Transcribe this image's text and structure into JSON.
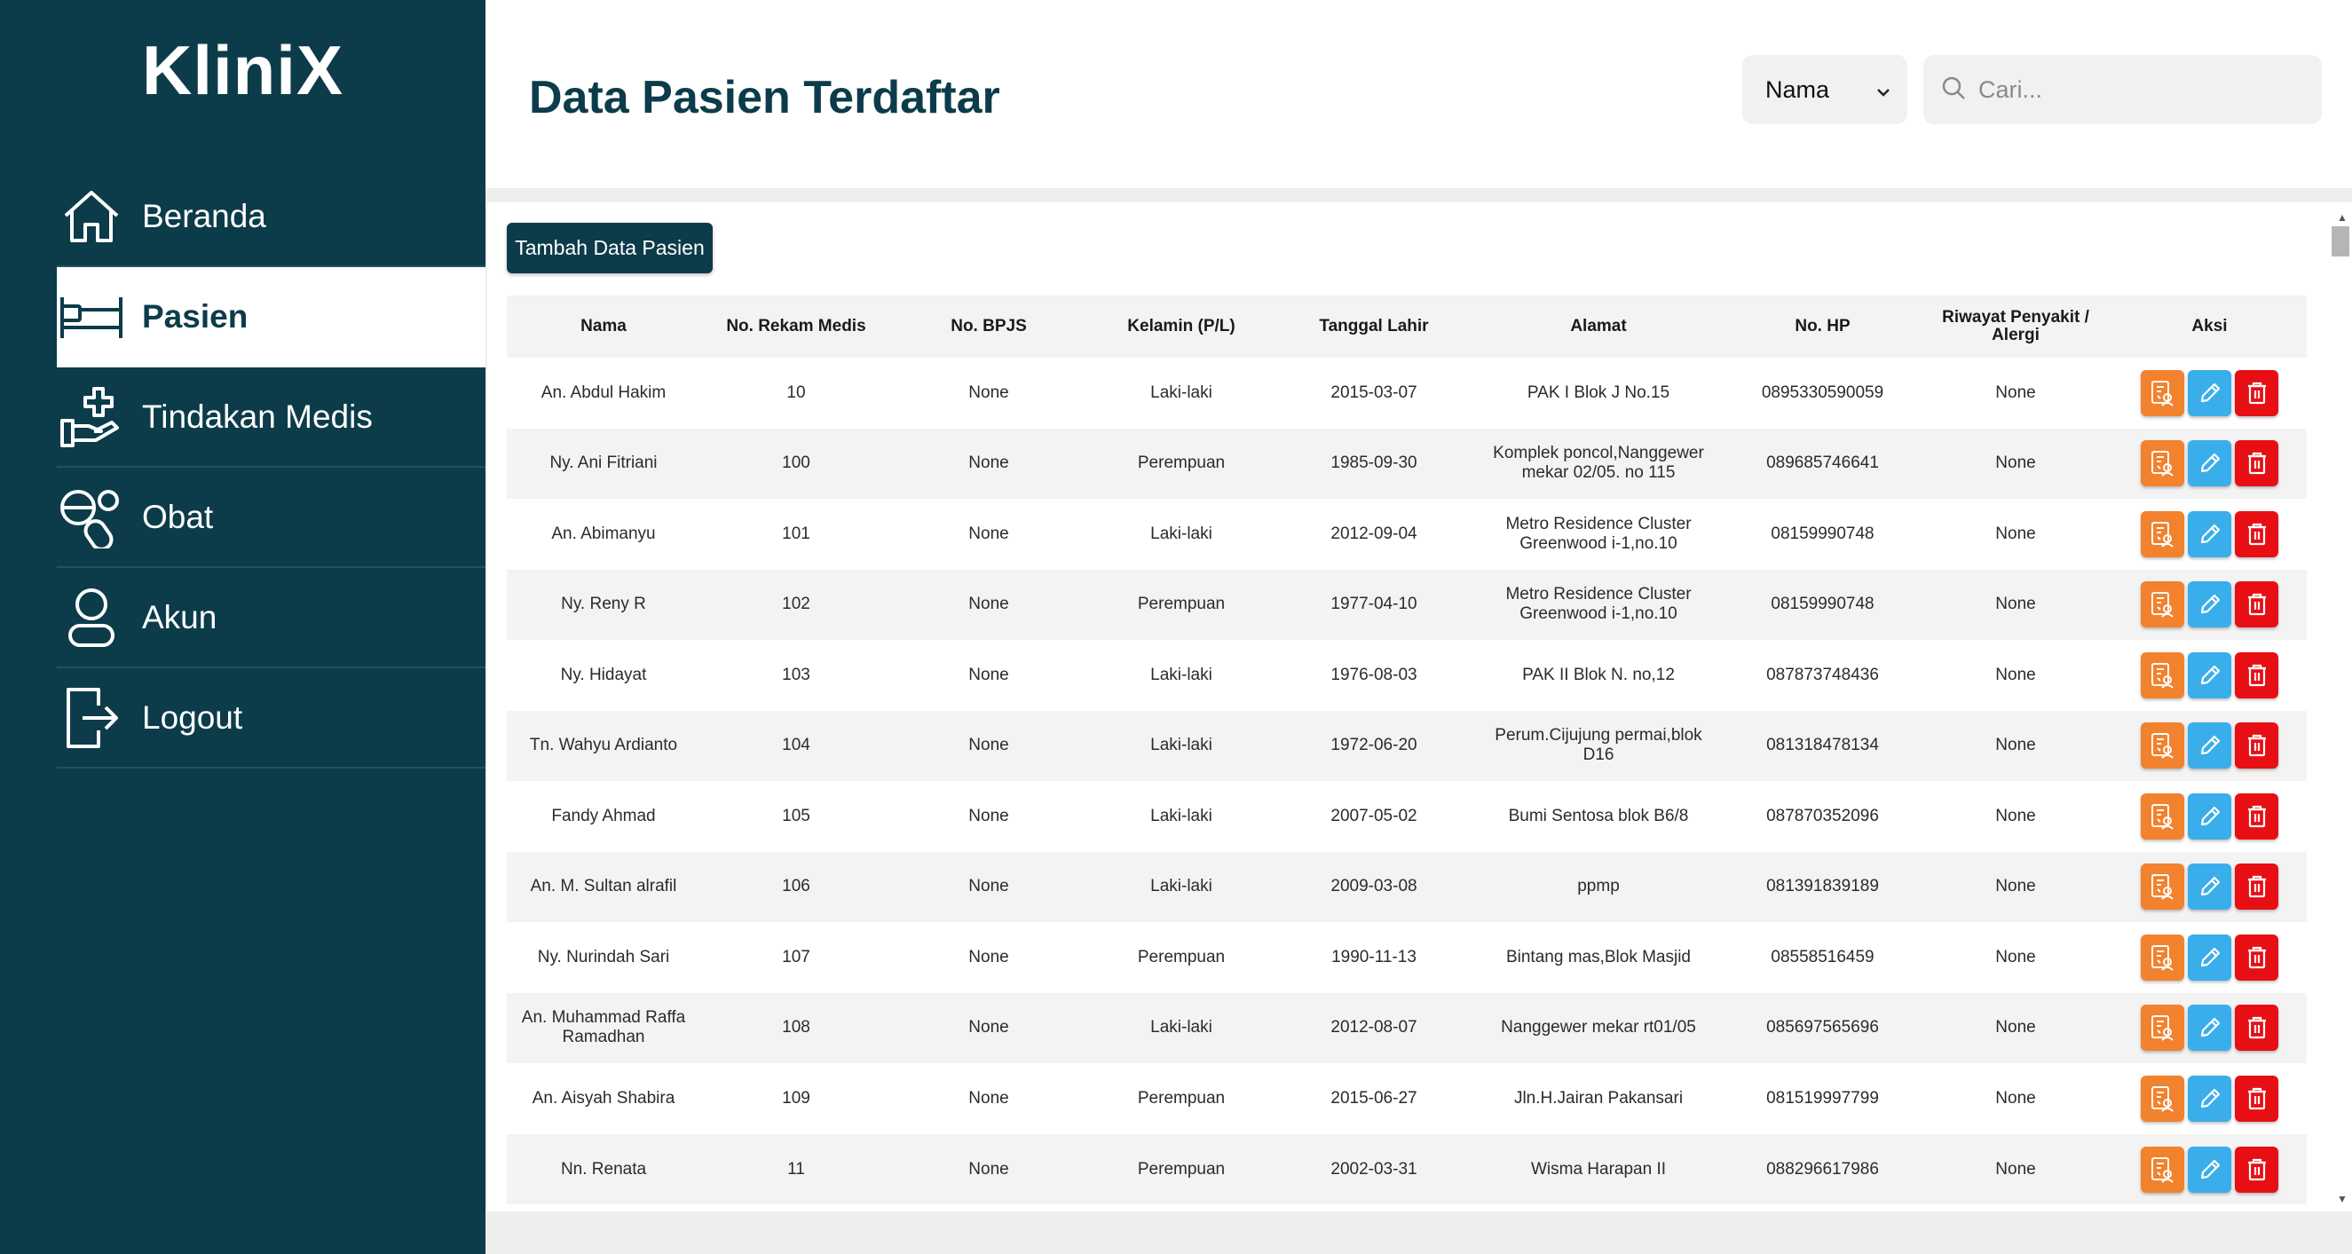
{
  "app": {
    "logo": "KliniX"
  },
  "sidebar": {
    "items": [
      {
        "label": "Beranda",
        "icon": "home-icon"
      },
      {
        "label": "Pasien",
        "icon": "bed-icon",
        "active": true
      },
      {
        "label": "Tindakan Medis",
        "icon": "hand-medical-icon"
      },
      {
        "label": "Obat",
        "icon": "pills-icon"
      },
      {
        "label": "Akun",
        "icon": "user-icon"
      },
      {
        "label": "Logout",
        "icon": "logout-icon"
      }
    ]
  },
  "header": {
    "title": "Data Pasien Terdaftar",
    "filter": {
      "selected": "Nama",
      "icon": "chevron-down-icon"
    },
    "search": {
      "placeholder": "Cari...",
      "value": "",
      "icon": "search-icon"
    }
  },
  "toolbar": {
    "add_label": "Tambah Data Pasien"
  },
  "table": {
    "columns": [
      "Nama",
      "No. Rekam Medis",
      "No. BPJS",
      "Kelamin (P/L)",
      "Tanggal Lahir",
      "Alamat",
      "No. HP",
      "Riwayat Penyakit / Alergi",
      "Aksi"
    ],
    "rows": [
      [
        "An. Abdul Hakim",
        "10",
        "None",
        "Laki-laki",
        "2015-03-07",
        "PAK I Blok J No.15",
        "0895330590059",
        "None"
      ],
      [
        "Ny. Ani Fitriani",
        "100",
        "None",
        "Perempuan",
        "1985-09-30",
        "Komplek poncol,Nanggewer mekar 02/05. no 115",
        "089685746641",
        "None"
      ],
      [
        "An. Abimanyu",
        "101",
        "None",
        "Laki-laki",
        "2012-09-04",
        "Metro Residence Cluster Greenwood i-1,no.10",
        "08159990748",
        "None"
      ],
      [
        "Ny. Reny R",
        "102",
        "None",
        "Perempuan",
        "1977-04-10",
        "Metro Residence Cluster Greenwood i-1,no.10",
        "08159990748",
        "None"
      ],
      [
        "Ny. Hidayat",
        "103",
        "None",
        "Laki-laki",
        "1976-08-03",
        "PAK II Blok N. no,12",
        "087873748436",
        "None"
      ],
      [
        "Tn. Wahyu Ardianto",
        "104",
        "None",
        "Laki-laki",
        "1972-06-20",
        "Perum.Cijujung permai,blok D16",
        "081318478134",
        "None"
      ],
      [
        "Fandy Ahmad",
        "105",
        "None",
        "Laki-laki",
        "2007-05-02",
        "Bumi Sentosa blok B6/8",
        "087870352096",
        "None"
      ],
      [
        "An. M. Sultan alrafil",
        "106",
        "None",
        "Laki-laki",
        "2009-03-08",
        "ppmp",
        "081391839189",
        "None"
      ],
      [
        "Ny. Nurindah Sari",
        "107",
        "None",
        "Perempuan",
        "1990-11-13",
        "Bintang mas,Blok Masjid",
        "08558516459",
        "None"
      ],
      [
        "An. Muhammad Raffa Ramadhan",
        "108",
        "None",
        "Laki-laki",
        "2012-08-07",
        "Nanggewer mekar rt01/05",
        "085697565696",
        "None"
      ],
      [
        "An. Aisyah Shabira",
        "109",
        "None",
        "Perempuan",
        "2015-06-27",
        "Jln.H.Jairan Pakansari",
        "081519997799",
        "None"
      ],
      [
        "Nn. Renata",
        "11",
        "None",
        "Perempuan",
        "2002-03-31",
        "Wisma Harapan II",
        "088296617986",
        "None"
      ]
    ],
    "row_actions": [
      {
        "name": "medical-record-button",
        "icon": "medical-record-icon",
        "color": "#f2822e"
      },
      {
        "name": "edit-button",
        "icon": "pencil-icon",
        "color": "#3aaeea"
      },
      {
        "name": "delete-button",
        "icon": "trash-icon",
        "color": "#e80f14"
      }
    ]
  },
  "colors": {
    "sidebar": "#0c3c4a",
    "accent": "#0c3c4a",
    "orange": "#f2822e",
    "blue": "#3aaeea",
    "red": "#e80f14"
  }
}
